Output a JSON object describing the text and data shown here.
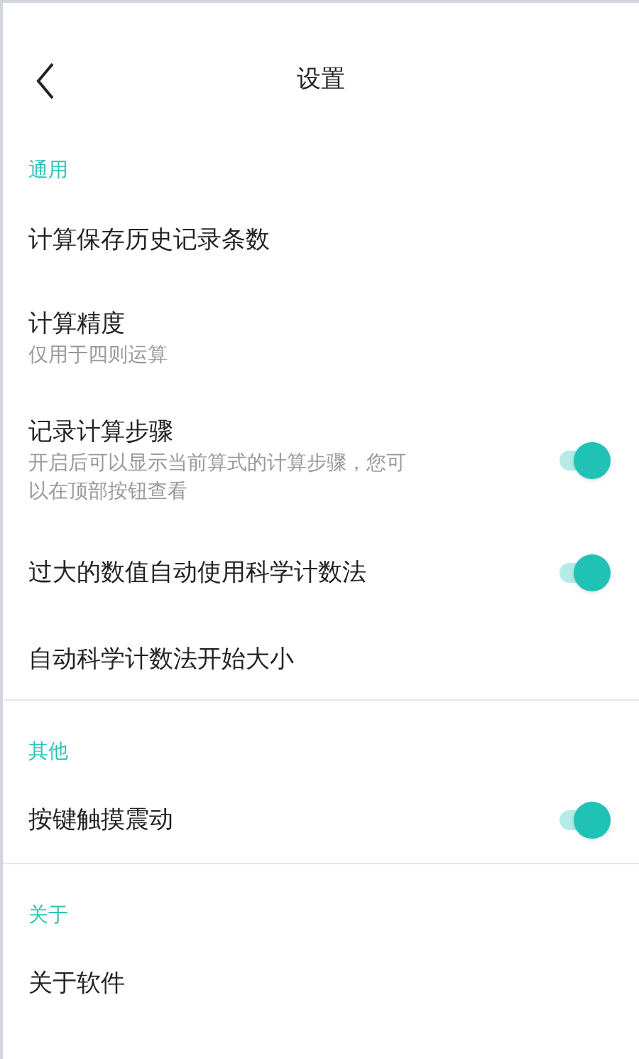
{
  "header": {
    "title": "设置"
  },
  "sections": [
    {
      "title": "通用",
      "items": [
        {
          "kind": "plain",
          "label": "计算保存历史记录条数"
        },
        {
          "kind": "plain",
          "label": "计算精度",
          "description": "仅用于四则运算"
        },
        {
          "kind": "toggle",
          "label": "记录计算步骤",
          "description": "开启后可以显示当前算式的计算步骤，您可以在顶部按钮查看",
          "on": true
        },
        {
          "kind": "toggle",
          "label": "过大的数值自动使用科学计数法",
          "on": true
        },
        {
          "kind": "plain",
          "label": "自动科学计数法开始大小"
        }
      ]
    },
    {
      "title": "其他",
      "items": [
        {
          "kind": "toggle",
          "label": "按键触摸震动",
          "on": true
        }
      ]
    },
    {
      "title": "关于",
      "items": [
        {
          "kind": "plain",
          "label": "关于软件"
        }
      ]
    }
  ]
}
